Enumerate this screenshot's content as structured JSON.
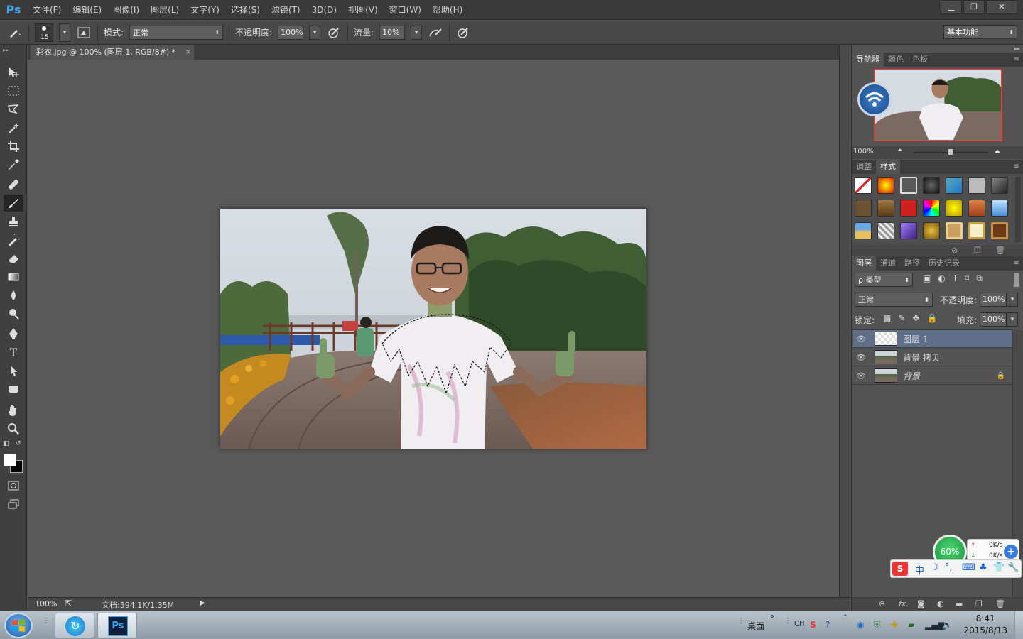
{
  "menubar": {
    "logo": "Ps",
    "items": [
      "文件(F)",
      "编辑(E)",
      "图像(I)",
      "图层(L)",
      "文字(Y)",
      "选择(S)",
      "滤镜(T)",
      "3D(D)",
      "视图(V)",
      "窗口(W)",
      "帮助(H)"
    ]
  },
  "options": {
    "brush_size": "15",
    "mode_label": "模式:",
    "mode_value": "正常",
    "opacity_label": "不透明度:",
    "opacity_value": "100%",
    "flow_label": "流量:",
    "flow_value": "10%",
    "workspace": "基本功能"
  },
  "document": {
    "tab_title": "彩衣.jpg @ 100% (图层 1, RGB/8#) *",
    "tab_close": "×"
  },
  "status": {
    "zoom": "100%",
    "doc_info": "文档:594.1K/1.35M"
  },
  "navigator_panel": {
    "tabs": [
      "导航器",
      "颜色",
      "色板"
    ],
    "zoom": "100%"
  },
  "styles_panel": {
    "tabs": [
      "调整",
      "样式"
    ]
  },
  "layers_panel": {
    "tabs": [
      "图层",
      "通道",
      "路径",
      "历史记录"
    ],
    "filter_label": "ρ 类型",
    "blend_mode": "正常",
    "opacity_label": "不透明度:",
    "opacity_value": "100%",
    "lock_label": "锁定:",
    "fill_label": "填充:",
    "fill_value": "100%",
    "layers": [
      {
        "name": "图层 1",
        "selected": true
      },
      {
        "name": "背景 拷贝",
        "selected": false
      },
      {
        "name": "背景",
        "selected": false,
        "locked": true
      }
    ],
    "footer_fx": "fx."
  },
  "widgets": {
    "speed_percent": "60%",
    "upload": "0K/s",
    "download": "0K/s",
    "ime_zh": "中"
  },
  "taskbar": {
    "desktop_label": "桌面",
    "lang": "CH",
    "time": "8:41",
    "date": "2015/8/13",
    "ps_app_label": "Ps"
  },
  "colors": {
    "accent_ps": "#3fa6ee",
    "selected_layer": "#5f6f8a",
    "nav_frame": "#e04040"
  }
}
